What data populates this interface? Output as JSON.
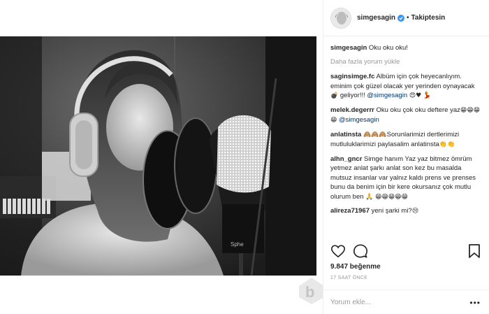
{
  "post": {
    "username": "simgesagin",
    "follow_state": "Takiptesin",
    "caption": "Oku oku oku!",
    "load_more_label": "Daha fazla yorum yükle",
    "likes": "9.847 beğenme",
    "timestamp": "17 SAAT ÖNCE",
    "comment_placeholder": "Yorum ekle...",
    "accent_color": "#3897f0"
  },
  "comments": [
    {
      "user": "saginsimge.fc",
      "text": "Albüm için çok heyecanlıyım. eminim çok güzel olacak yer yerinden oynayacak",
      "emoji1": "💣",
      "text2": "geliyor!!!",
      "mention": "@simgesagin",
      "emoji2": "😍♥",
      "emoji3": "💃"
    },
    {
      "user": "melek.degerrr",
      "text": "Oku oku çok oku deftere yaz",
      "emoji1": "😁😁😁😁",
      "mention": "@simgesagin"
    },
    {
      "user": "anlatinsta",
      "emoji1": "🙈🙈🙈",
      "text": "Sorunlarimizi dertlerimizi mutluluklarimizi paylasalim anlatinsta",
      "emoji2": "👏👏"
    },
    {
      "user": "alhn_gncr",
      "text": "Simge hanım Yaz yaz bitmez ömrüm yetmez anlat şarkı anlat son kez bu masalda mutsuz insanlar var yalnız kaldı prens ve prenses bunu da benim için bir kere okursanız çok mutlu olurum ben",
      "emoji1": "🙏",
      "emoji2": "😁😁😁😁😁"
    },
    {
      "user": "alireza71967",
      "text": "yeni şarki mi?",
      "emoji1": "😢"
    }
  ],
  "icons": {
    "like": "heart-icon",
    "comment": "comment-bubble-icon",
    "save": "bookmark-icon",
    "more": "more-options-icon",
    "verified": "verified-badge-icon"
  }
}
